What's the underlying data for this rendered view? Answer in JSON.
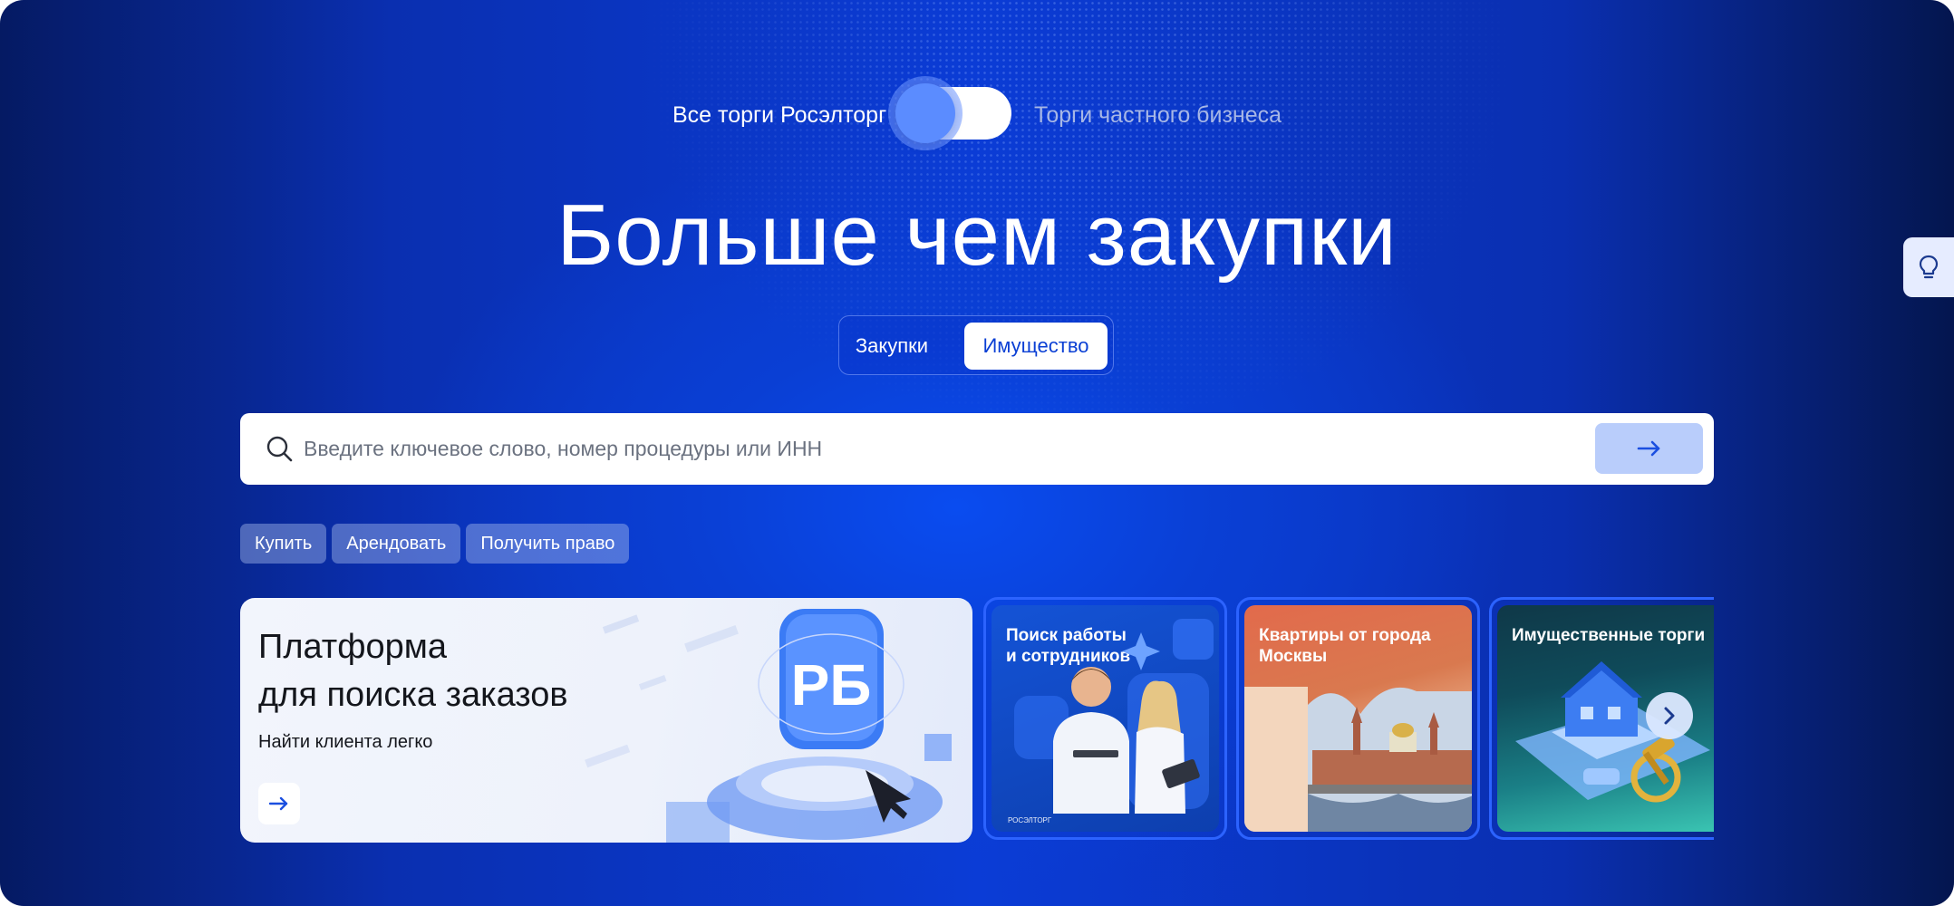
{
  "mode_toggle": {
    "left_label": "Все торги Росэлторг",
    "right_label": "Торги частного бизнеса"
  },
  "headline": "Больше чем закупки",
  "segments": {
    "tab1": "Закупки",
    "tab2": "Имущество",
    "active": "Имущество"
  },
  "search": {
    "placeholder": "Введите ключевое слово, номер процедуры или ИНН",
    "value": ""
  },
  "chips": [
    "Купить",
    "Арендовать",
    "Получить право"
  ],
  "cards": {
    "main": {
      "title_line1": "Платформа",
      "title_line2": "для поиска заказов",
      "subtitle": "Найти клиента легко"
    },
    "jobs": {
      "title_line1": "Поиск работы",
      "title_line2": "и сотрудников"
    },
    "flats": {
      "title_line1": "Квартиры от города",
      "title_line2": "Москвы"
    },
    "property": {
      "title": "Имущественные торги"
    }
  },
  "icons": {
    "search": "search-icon",
    "arrow": "arrow-right-icon",
    "next": "chevron-right-icon",
    "side": "lightbulb-icon"
  },
  "colors": {
    "brand_blue": "#0a3fd4",
    "accent_light": "#b9cdfb",
    "card_border": "#2c63ff"
  }
}
